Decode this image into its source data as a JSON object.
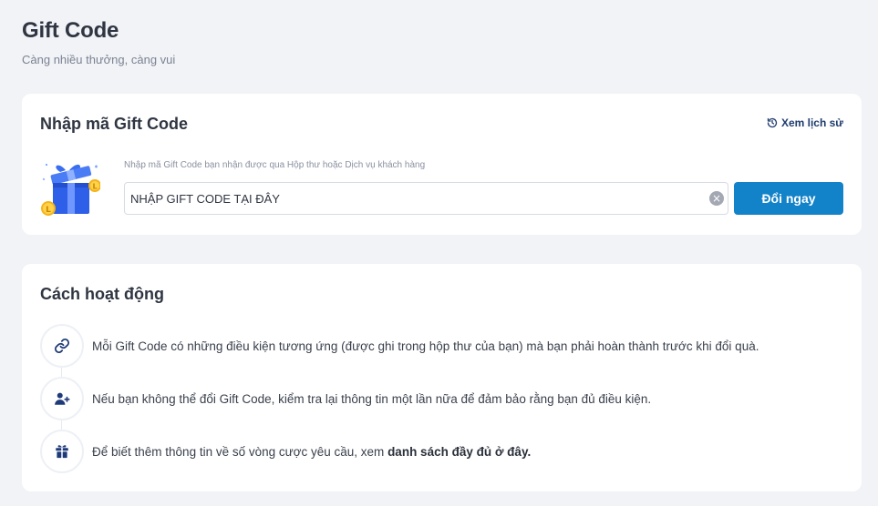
{
  "header": {
    "title": "Gift Code",
    "subtitle": "Càng nhiều thưởng, càng vui"
  },
  "redeem": {
    "title": "Nhập mã Gift Code",
    "history_label": "Xem lịch sử",
    "hint": "Nhập mã Gift Code bạn nhận được qua Hộp thư hoặc Dịch vụ khách hàng",
    "input_placeholder": "NHẬP GIFT CODE TẠI ĐÂY",
    "input_value": "",
    "clear_symbol": "×",
    "button_label": "Đổi ngay"
  },
  "how": {
    "title": "Cách hoạt động",
    "steps": [
      {
        "icon": "link-icon",
        "text": "Mỗi Gift Code có những điều kiện tương ứng (được ghi trong hộp thư của bạn) mà bạn phải hoàn thành trước khi đổi quà."
      },
      {
        "icon": "user-plus-icon",
        "text": "Nếu bạn không thể đổi Gift Code, kiểm tra lại thông tin một lần nữa để đảm bảo rằng bạn đủ điều kiện."
      },
      {
        "icon": "gift-icon",
        "text_prefix": "Để biết thêm thông tin về số vòng cược yêu cầu, xem ",
        "link_text": "danh sách đầy đủ ở đây."
      }
    ]
  },
  "colors": {
    "background": "#f1f3f7",
    "accent": "#1282c9",
    "link": "#1f3c6e",
    "icon": "#1e3a78"
  }
}
